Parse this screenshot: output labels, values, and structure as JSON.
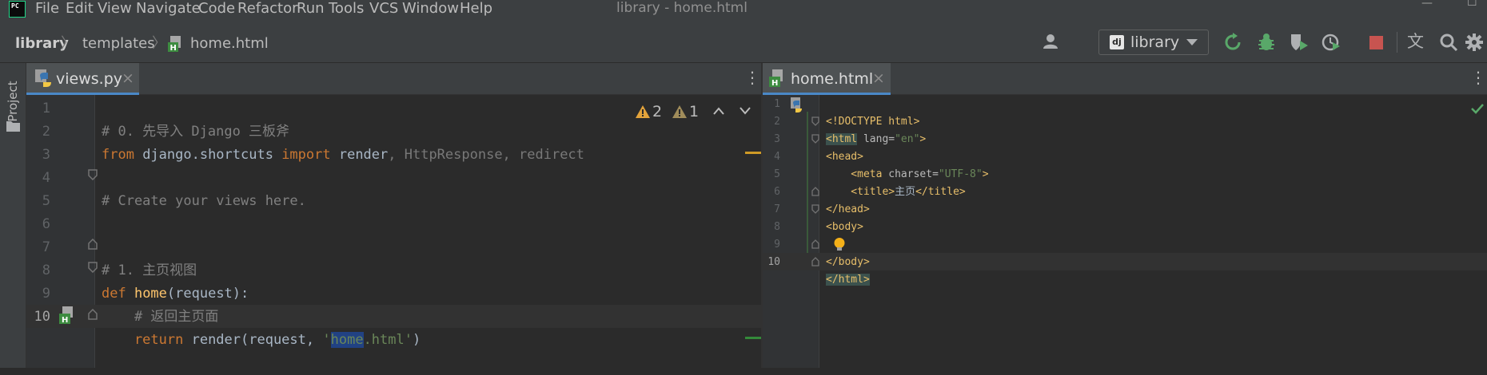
{
  "app": {
    "logo_text": "PC",
    "window_title": "library - home.html"
  },
  "menu": [
    "File",
    "Edit",
    "View",
    "Navigate",
    "Code",
    "Refactor",
    "Run",
    "Tools",
    "VCS",
    "Window",
    "Help"
  ],
  "window_controls": {
    "minimize": "—",
    "maximize": "☐"
  },
  "breadcrumb": {
    "project": "library",
    "folder": "templates",
    "file": "home.html",
    "separator": "〉"
  },
  "toolbar": {
    "run_config": "library",
    "run_config_icon": "dj"
  },
  "sidebar": {
    "project_label": "Project"
  },
  "left_editor": {
    "tab": {
      "label": "views.py",
      "close": "×"
    },
    "inspections": {
      "warnings": "2",
      "weak_warnings": "1"
    },
    "line_numbers": [
      "1",
      "2",
      "3",
      "4",
      "5",
      "6",
      "7",
      "8",
      "9",
      "10"
    ],
    "lines": {
      "l1": "# 0. 先导入 Django 三板斧",
      "l2_from": "from",
      "l2_mod": " django.shortcuts ",
      "l2_import": "import",
      "l2_render": " render",
      "l2_rest": ", HttpResponse, redirect",
      "l4": "# Create your views here.",
      "l7": "# 1. 主页视图",
      "l8_def": "def",
      "l8_name": " home",
      "l8_args": "(request):",
      "l9": "    # 返回主页面",
      "l10_return": "    return",
      "l10_call": " render(request, ",
      "l10_q1": "'",
      "l10_sel": "home",
      "l10_rest": ".html",
      "l10_q2": "'",
      "l10_end": ")"
    }
  },
  "right_editor": {
    "tab": {
      "label": "home.html",
      "close": "×"
    },
    "line_numbers": [
      "1",
      "2",
      "3",
      "4",
      "5",
      "6",
      "7",
      "8",
      "9",
      "10"
    ],
    "lines": {
      "l1": "<!DOCTYPE html>",
      "l2_open": "<html",
      "l2_attr": " lang=",
      "l2_val": "\"en\"",
      "l2_close": ">",
      "l3": "<head>",
      "l4_open": "    <meta",
      "l4_attr": " charset=",
      "l4_val": "\"UTF-8\"",
      "l4_close": ">",
      "l5_open": "    <title>",
      "l5_text": "主页",
      "l5_close": "</title>",
      "l6": "</head>",
      "l7": "<body>",
      "l9_a": "</",
      "l9_b": "body>",
      "l10": "</html>"
    }
  },
  "colors": {
    "background": "#2b2b2b",
    "chrome": "#3c3f41",
    "keyword": "#cc7832",
    "string": "#6a8759",
    "tag": "#e8bf6a",
    "comment": "#808080",
    "warning": "#e3a33b"
  }
}
